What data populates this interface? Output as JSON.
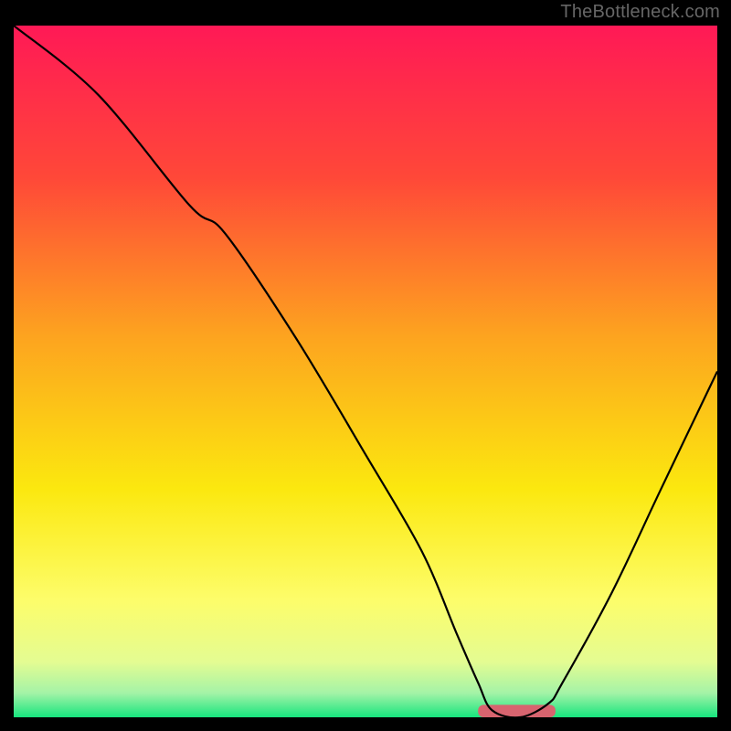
{
  "watermark": "TheBottleneck.com",
  "chart_data": {
    "type": "line",
    "title": "",
    "xlabel": "",
    "ylabel": "",
    "xlim": [
      0,
      100
    ],
    "ylim": [
      0,
      100
    ],
    "grid": false,
    "legend": false,
    "background_gradient_stops": [
      {
        "pos": 0.0,
        "color": "#ff1956"
      },
      {
        "pos": 0.22,
        "color": "#ff4838"
      },
      {
        "pos": 0.45,
        "color": "#fda41f"
      },
      {
        "pos": 0.67,
        "color": "#fbe80f"
      },
      {
        "pos": 0.83,
        "color": "#fdfd6a"
      },
      {
        "pos": 0.92,
        "color": "#e4fc92"
      },
      {
        "pos": 0.965,
        "color": "#a4f3a7"
      },
      {
        "pos": 1.0,
        "color": "#17e57e"
      }
    ],
    "series": [
      {
        "name": "bottleneck-curve",
        "color": "#000000",
        "x": [
          0,
          12,
          25,
          30,
          40,
          50,
          58,
          63,
          66,
          68,
          72,
          76,
          78,
          85,
          92,
          100
        ],
        "y": [
          100,
          90,
          74,
          70,
          55,
          38,
          24,
          12,
          5,
          1,
          0,
          2,
          5,
          18,
          33,
          50
        ]
      }
    ],
    "marker": {
      "name": "optimal-range",
      "color": "#d8646f",
      "x_start": 66,
      "x_end": 77,
      "y": 0,
      "height_pct": 1.8
    }
  }
}
